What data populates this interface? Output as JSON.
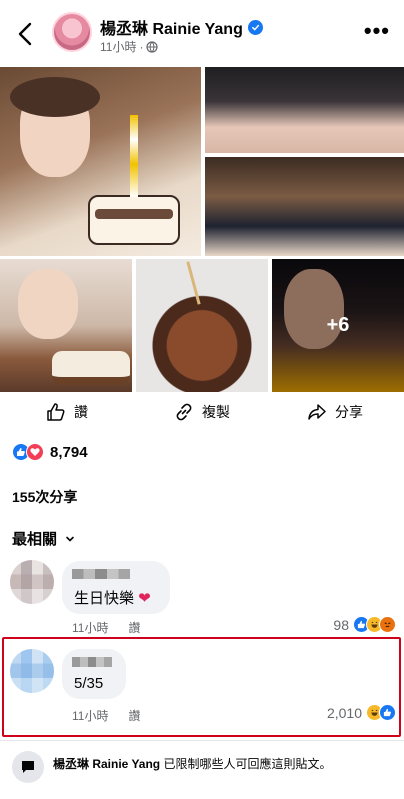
{
  "header": {
    "name": "楊丞琳 Rainie Yang",
    "time": "11小時",
    "separator": "·",
    "more": "•••"
  },
  "photos": {
    "more_count": "+6"
  },
  "actions": {
    "like": "讚",
    "copy": "複製",
    "share": "分享"
  },
  "reactions": {
    "count": "8,794"
  },
  "shares": "155次分享",
  "sort": "最相關",
  "comments": [
    {
      "text": "生日快樂",
      "time": "11小時",
      "like": "讚",
      "reaction_count": "98"
    },
    {
      "text": "5/35",
      "time": "11小時",
      "like": "讚",
      "reaction_count": "2,010"
    }
  ],
  "notice": {
    "name": "楊丞琳 Rainie Yang",
    "text": " 已限制哪些人可回應這則貼文。"
  },
  "colors": {
    "facebook_blue": "#1877f2",
    "love_red": "#f33e58",
    "highlight_border": "#d0021b"
  }
}
